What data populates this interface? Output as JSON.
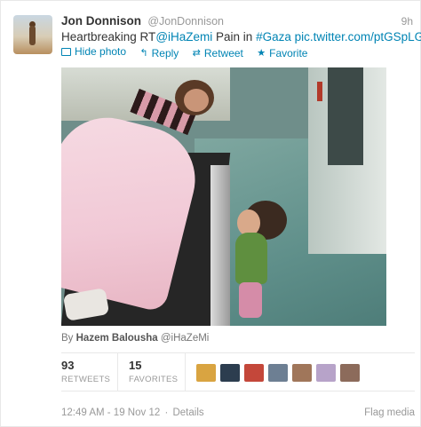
{
  "tweet": {
    "fullname": "Jon Donnison",
    "username": "@JonDonnison",
    "time": "9h",
    "text_parts": {
      "t1": "Heartbreaking RT",
      "mention": "@iHaZemi",
      "t2": " Pain in ",
      "hashtag": "#Gaza",
      "t3": " ",
      "url": "pic.twitter.com/ptGSpLGc"
    },
    "actions": {
      "hide_photo": "Hide photo",
      "reply": "Reply",
      "retweet": "Retweet",
      "favorite": "Favorite"
    },
    "byline": {
      "prefix": "By ",
      "name": "Hazem Balousha",
      "handle": "@iHaZeMi"
    },
    "stats": {
      "retweets_count": "93",
      "retweets_label": "RETWEETS",
      "favorites_count": "15",
      "favorites_label": "FAVORITES"
    },
    "favoriters": [
      {
        "name": "favoriter-avatar-1",
        "color": "#d9a441"
      },
      {
        "name": "favoriter-avatar-2",
        "color": "#2c3d4f"
      },
      {
        "name": "favoriter-avatar-3",
        "color": "#c4473a"
      },
      {
        "name": "favoriter-avatar-4",
        "color": "#6d7f93"
      },
      {
        "name": "favoriter-avatar-5",
        "color": "#a0765a"
      },
      {
        "name": "favoriter-avatar-6",
        "color": "#b7a3c9"
      },
      {
        "name": "favoriter-avatar-7",
        "color": "#8c6b5b"
      }
    ],
    "footer": {
      "timestamp": "12:49 AM - 19 Nov 12",
      "separator": "·",
      "details": "Details",
      "flag": "Flag media"
    },
    "icons": {
      "photo": "photo-icon",
      "reply": "reply-arrow-icon",
      "retweet": "retweet-arrows-icon",
      "favorite": "star-icon"
    },
    "colors": {
      "link": "#0084b4",
      "muted": "#999999",
      "text": "#333333"
    }
  }
}
